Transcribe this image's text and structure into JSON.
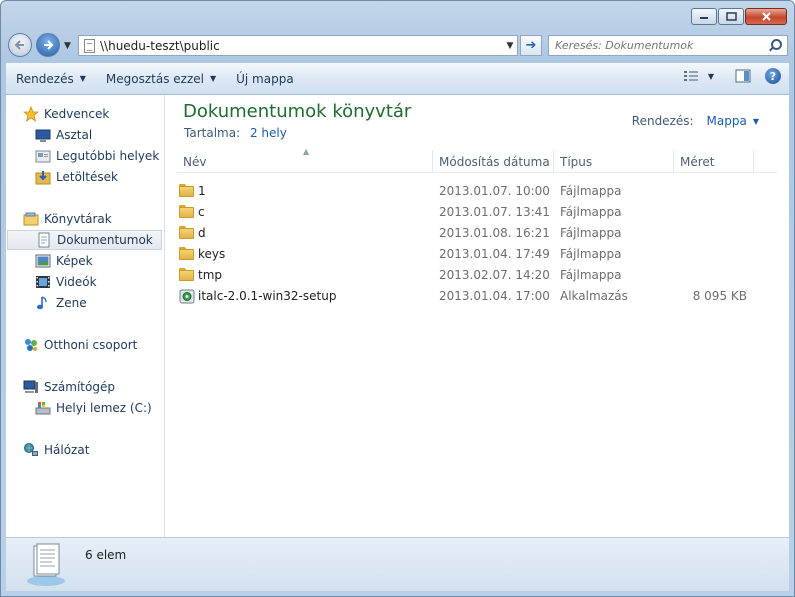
{
  "window": {
    "caption_buttons": {
      "minimize": "minimize-icon",
      "maximize": "maximize-icon",
      "close": "close-icon"
    }
  },
  "address": {
    "path": "\\\\huedu-teszt\\public",
    "search_placeholder": "Keresés: Dokumentumok"
  },
  "toolbar": {
    "organize": "Rendezés",
    "share": "Megosztás ezzel",
    "new_folder": "Új mappa"
  },
  "sidebar": {
    "favorites": "Kedvencek",
    "desktop": "Asztal",
    "recent": "Legutóbbi helyek",
    "downloads": "Letöltések",
    "libraries": "Könyvtárak",
    "documents": "Dokumentumok",
    "pictures": "Képek",
    "videos": "Videók",
    "music": "Zene",
    "homegroup": "Otthoni csoport",
    "computer": "Számítógép",
    "local_disk": "Helyi lemez (C:)",
    "network": "Hálózat"
  },
  "library": {
    "title": "Dokumentumok könyvtár",
    "includes_label": "Tartalma:",
    "includes_value": "2 hely",
    "arrange_label": "Rendezés:",
    "arrange_value": "Mappa"
  },
  "columns": {
    "name": "Név",
    "modified": "Módosítás dátuma",
    "type": "Típus",
    "size": "Méret"
  },
  "files": [
    {
      "name": "1",
      "modified": "2013.01.07. 10:00",
      "type": "Fájlmappa",
      "size": "",
      "icon": "folder-icon"
    },
    {
      "name": "c",
      "modified": "2013.01.07. 13:41",
      "type": "Fájlmappa",
      "size": "",
      "icon": "folder-icon"
    },
    {
      "name": "d",
      "modified": "2013.01.08. 16:21",
      "type": "Fájlmappa",
      "size": "",
      "icon": "folder-icon"
    },
    {
      "name": "keys",
      "modified": "2013.01.04. 17:49",
      "type": "Fájlmappa",
      "size": "",
      "icon": "folder-icon"
    },
    {
      "name": "tmp",
      "modified": "2013.02.07. 14:20",
      "type": "Fájlmappa",
      "size": "",
      "icon": "folder-icon"
    },
    {
      "name": "italc-2.0.1-win32-setup",
      "modified": "2013.01.04. 17:00",
      "type": "Alkalmazás",
      "size": "8 095 KB",
      "icon": "installer-icon"
    }
  ],
  "status": {
    "count": "6 elem"
  }
}
